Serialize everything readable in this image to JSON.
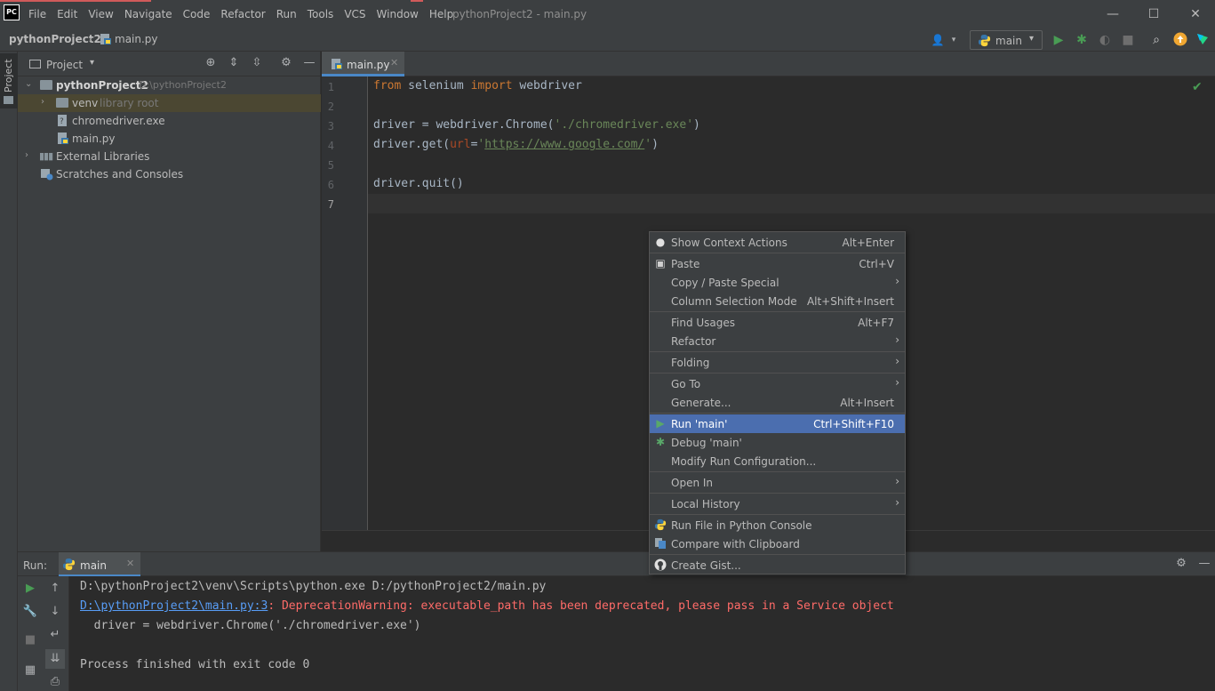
{
  "window": {
    "title": "pythonProject2 - main.py",
    "menu": [
      "File",
      "Edit",
      "View",
      "Navigate",
      "Code",
      "Refactor",
      "Run",
      "Tools",
      "VCS",
      "Window",
      "Help"
    ],
    "logo_text": "PC"
  },
  "navbar": {
    "project": "pythonProject2",
    "file": "main.py",
    "run_config": "main"
  },
  "left_strip": {
    "project_tab": "Project"
  },
  "project_panel": {
    "title": "Project",
    "tree": [
      {
        "label": "pythonProject2",
        "hint": "D:\\pythonProject2",
        "type": "folder",
        "expanded": true
      },
      {
        "label": "venv",
        "hint": "library root",
        "type": "folder",
        "expanded": false
      },
      {
        "label": "chromedriver.exe",
        "type": "file"
      },
      {
        "label": "main.py",
        "type": "python"
      },
      {
        "label": "External Libraries",
        "type": "library",
        "expanded": false
      },
      {
        "label": "Scratches and Consoles",
        "type": "scratch"
      }
    ]
  },
  "editor": {
    "tab": "main.py",
    "line_numbers": [
      "1",
      "2",
      "3",
      "4",
      "5",
      "6",
      "7"
    ],
    "code": {
      "l1_kw1": "from",
      "l1_mid": " selenium ",
      "l1_kw2": "import",
      "l1_end": " webdriver",
      "l3_a": "driver = webdriver.Chrome(",
      "l3_str": "'./chromedriver.exe'",
      "l3_b": ")",
      "l4_a": "driver.get(",
      "l4_param": "url",
      "l4_eq": "=",
      "l4_q1": "'",
      "l4_url": "https://www.google.com/",
      "l4_q2": "'",
      "l4_b": ")",
      "l6": "driver.quit()"
    }
  },
  "run_panel": {
    "label": "Run:",
    "tab": "main",
    "console": {
      "line1": "D:\\pythonProject2\\venv\\Scripts\\python.exe D:/pythonProject2/main.py",
      "line2_link": "D:\\pythonProject2\\main.py:3",
      "line2_msg": ": DeprecationWarning: executable_path has been deprecated, please pass in a Service object",
      "line3": "  driver = webdriver.Chrome('./chromedriver.exe')",
      "line5": "Process finished with exit code 0"
    }
  },
  "context_menu": {
    "items": [
      {
        "label": "Show Context Actions",
        "shortcut": "Alt+Enter",
        "icon": "lightbulb-icon"
      },
      {
        "label": "Paste",
        "shortcut": "Ctrl+V",
        "icon": "clipboard-icon"
      },
      {
        "label": "Copy / Paste Special",
        "submenu": true
      },
      {
        "label": "Column Selection Mode",
        "shortcut": "Alt+Shift+Insert"
      },
      {
        "label": "Find Usages",
        "shortcut": "Alt+F7"
      },
      {
        "label": "Refactor",
        "submenu": true
      },
      {
        "label": "Folding",
        "submenu": true
      },
      {
        "label": "Go To",
        "submenu": true
      },
      {
        "label": "Generate...",
        "shortcut": "Alt+Insert"
      },
      {
        "label": "Run 'main'",
        "shortcut": "Ctrl+Shift+F10",
        "icon": "run-icon",
        "highlighted": true
      },
      {
        "label": "Debug 'main'",
        "icon": "debug-icon"
      },
      {
        "label": "Modify Run Configuration..."
      },
      {
        "label": "Open In",
        "submenu": true
      },
      {
        "label": "Local History",
        "submenu": true
      },
      {
        "label": "Run File in Python Console",
        "icon": "python-icon"
      },
      {
        "label": "Compare with Clipboard",
        "icon": "compare-icon"
      },
      {
        "label": "Create Gist...",
        "icon": "github-icon"
      }
    ],
    "submenu_arrow": "›"
  },
  "colors": {
    "accent": "#4b6eaf",
    "keyword": "#cc7832",
    "string": "#6a8759",
    "error": "#ff6b68",
    "link": "#589df6",
    "run_green": "#499c54"
  }
}
